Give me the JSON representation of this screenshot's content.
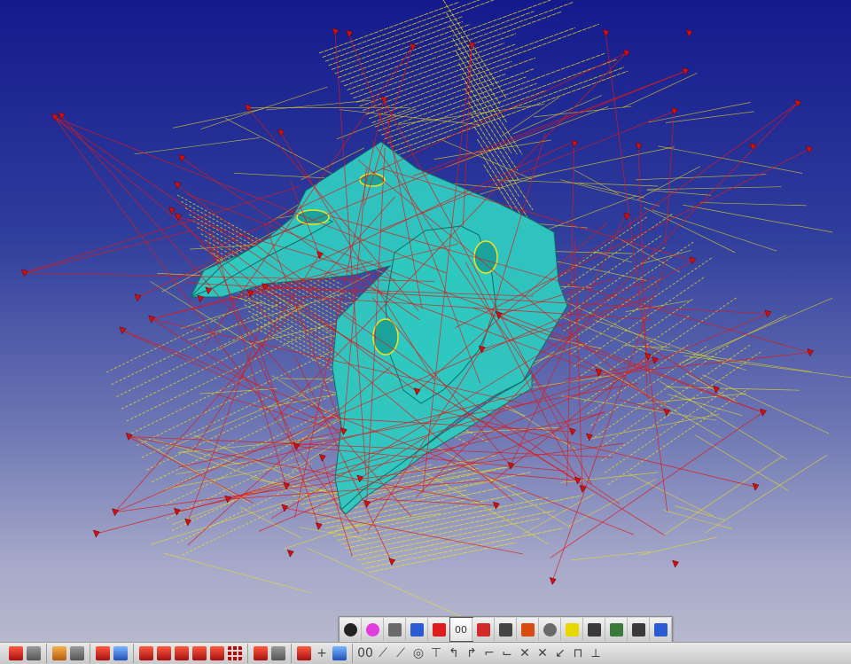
{
  "viewport": {
    "background_top": "#141a8c",
    "background_bottom": "#bcbdd0",
    "part_color": "#2fc9c0",
    "toolpath_yellow": "#f4e21a",
    "toolpath_red": "#e01818",
    "tool_marker_color": "#d01010"
  },
  "floating_toolbar": {
    "buttons": [
      {
        "name": "shaded-sphere-icon"
      },
      {
        "name": "color-sphere-icon"
      },
      {
        "name": "sketch-pencil-icon"
      },
      {
        "name": "edit-tool-icon"
      },
      {
        "name": "star-pick-icon"
      },
      {
        "name": "toolpath-icon",
        "label": "00",
        "active": true
      },
      {
        "name": "point-tool-icon"
      },
      {
        "name": "holder-tool-icon"
      },
      {
        "name": "pen-tool-icon"
      },
      {
        "name": "globe-icon"
      },
      {
        "name": "bulb-icon"
      },
      {
        "name": "magnify-icon"
      },
      {
        "name": "layers-icon"
      },
      {
        "name": "ruler-icon"
      },
      {
        "name": "wand-icon"
      }
    ]
  },
  "bottom_toolbar": {
    "toolpath_label": "00"
  }
}
